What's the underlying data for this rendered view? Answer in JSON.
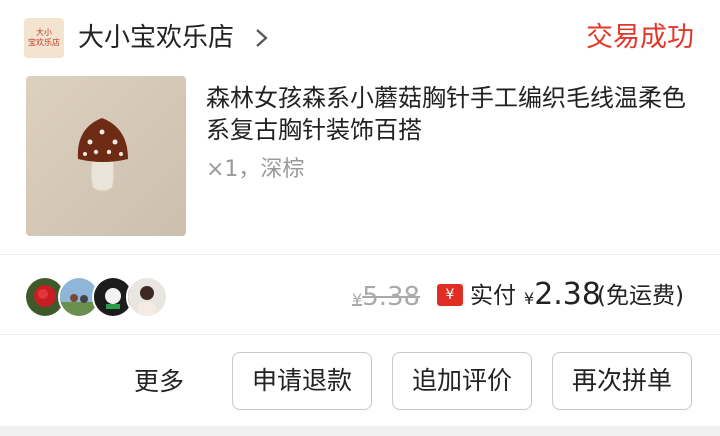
{
  "shop": {
    "logo_line1": "大小",
    "logo_line2": "宝欢乐店",
    "name": "大小宝欢乐店",
    "logo_icon": "shop-logo"
  },
  "order": {
    "status": "交易成功",
    "status_color": "#e0392b"
  },
  "product": {
    "title": "森林女孩森系小蘑菇胸针手工编织毛线温柔色系复古胸针装饰百搭",
    "sku": "×1，深棕",
    "thumbnail_icon": "mushroom-brooch-image"
  },
  "price": {
    "original": "5.38",
    "original_currency": "¥",
    "paid_icon": "¥",
    "paid_label": "实付",
    "paid_currency": "¥",
    "paid_amount": "2.38",
    "shipping_note": "(免运费)",
    "accent_color": "#e02e24"
  },
  "group": {
    "avatars": [
      "rose-avatar",
      "family-photo-avatar",
      "cartoon-avatar",
      "person-avatar"
    ]
  },
  "actions": {
    "more": "更多",
    "refund": "申请退款",
    "review": "追加评价",
    "reorder": "再次拼单"
  }
}
